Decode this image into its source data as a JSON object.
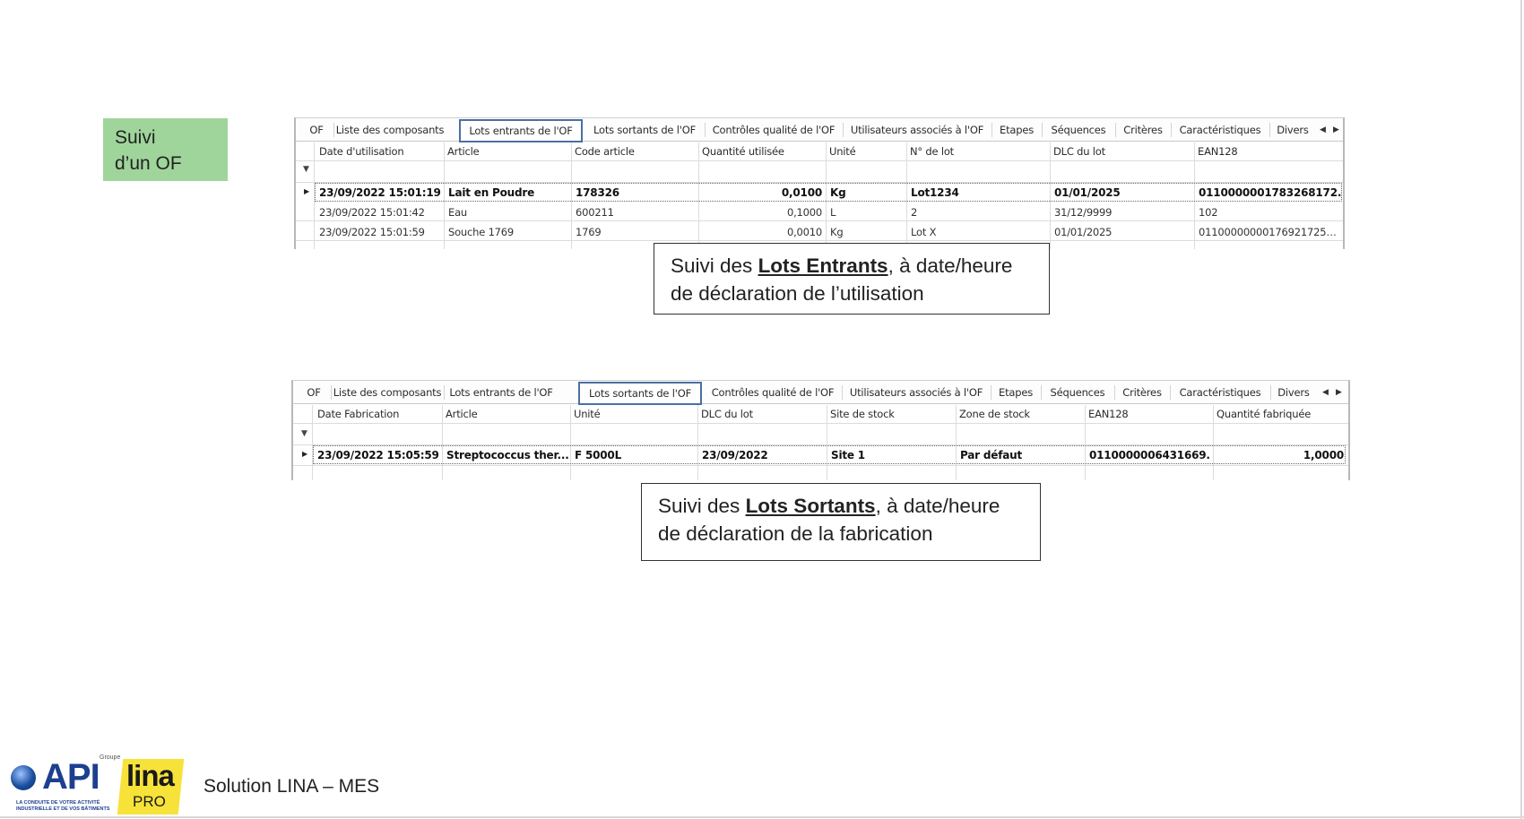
{
  "title": {
    "line1": "Suivi",
    "line2": "d’un OF"
  },
  "panel1": {
    "tabs": [
      "OF",
      "Liste des composants",
      "Lots entrants de l'OF",
      "Lots sortants de l'OF",
      "Contrôles qualité de l'OF",
      "Utilisateurs associés à l'OF",
      "Etapes",
      "Séquences",
      "Critères",
      "Caractéristiques",
      "Divers"
    ],
    "active_tab": "Lots entrants de l'OF",
    "columns": [
      "Date d'utilisation",
      "Article",
      "Code article",
      "Quantité utilisée",
      "Unité",
      "N° de lot",
      "DLC du lot",
      "EAN128"
    ],
    "rows": [
      [
        "23/09/2022 15:01:19",
        "Lait en Poudre",
        "178326",
        "0,0100",
        "Kg",
        "Lot1234",
        "01/01/2025",
        "0110000001783268172..."
      ],
      [
        "23/09/2022 15:01:42",
        "Eau",
        "600211",
        "0,1000",
        "L",
        "2",
        "31/12/9999",
        "102"
      ],
      [
        "23/09/2022 15:01:59",
        "Souche 1769",
        "1769",
        "0,0010",
        "Kg",
        "Lot X",
        "01/01/2025",
        "0110000000017692172501 0..."
      ]
    ],
    "selected_row": 0
  },
  "callout1": {
    "prefix": "Suivi des ",
    "emphasis": "Lots Entrants",
    "suffix": ", à date/heure",
    "line2": "de déclaration de l’utilisation"
  },
  "panel2": {
    "tabs": [
      "OF",
      "Liste des composants",
      "Lots entrants de l'OF",
      "Lots sortants de l'OF",
      "Contrôles qualité de l'OF",
      "Utilisateurs associés à l'OF",
      "Etapes",
      "Séquences",
      "Critères",
      "Caractéristiques",
      "Divers"
    ],
    "active_tab": "Lots sortants de l'OF",
    "columns": [
      "Date Fabrication",
      "Article",
      "Unité",
      "DLC du lot",
      "Site de stock",
      "Zone de stock",
      "EAN128",
      "Quantité fabriquée"
    ],
    "rows": [
      [
        "23/09/2022 15:05:59",
        "Streptococcus ther...",
        "F 5000L",
        "23/09/2022",
        "Site 1",
        "Par défaut",
        "0110000006431669...",
        "1,0000"
      ]
    ],
    "selected_row": 0
  },
  "callout2": {
    "prefix": "Suivi des ",
    "emphasis": "Lots Sortants",
    "suffix": ", à date/heure",
    "line2": "de déclaration de la fabrication"
  },
  "logo": {
    "groupe": "Groupe",
    "api": "API",
    "api_tagline": "LA CONDUITE DE VOTRE ACTIVITÉ INDUSTRIELLE ET DE VOS BÂTIMENTS",
    "lina": "lina",
    "pro": "PRO"
  },
  "footer": {
    "text": "Solution LINA – MES"
  },
  "icons": {
    "filter": "filter-icon",
    "row_indicator": "row-indicator-icon",
    "scroll_left": "chevron-left-icon",
    "scroll_right": "chevron-right-icon"
  },
  "colors": {
    "title_bg": "#9fd59a",
    "active_tab_border": "#4a6fa3",
    "logo_blue": "#1d3f8f",
    "logo_yellow": "#f7e23a"
  }
}
